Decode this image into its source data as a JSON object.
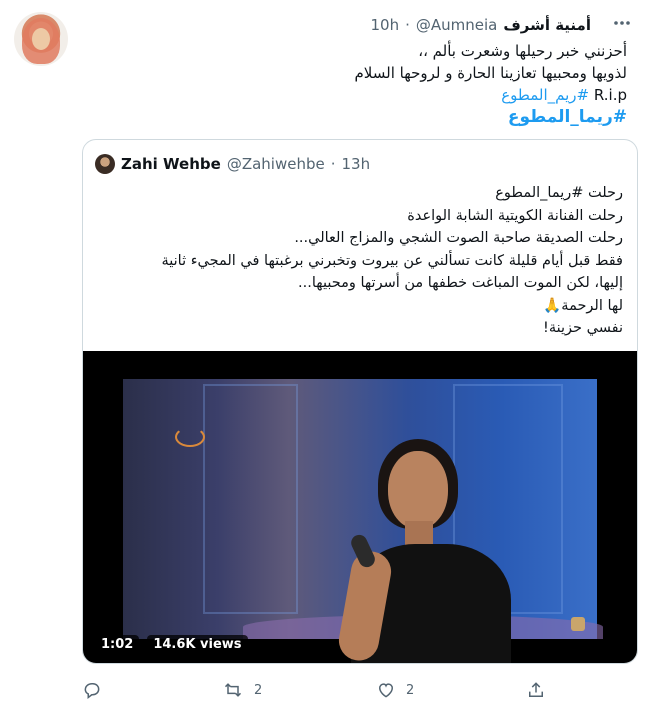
{
  "tweet": {
    "display_name": "أمنية أشرف",
    "handle": "@Aumneia",
    "separator": "·",
    "time": "10h",
    "lines": [
      "أحزنني خبر رحيلها وشعرت بألم ،،",
      "لذويها ومحبيها تعازينا الحارة و لروحها السلام"
    ],
    "rip_text": "R.i.p",
    "hashtag_inline": "#ريم_المطوع",
    "hashtag_bold": "#ريما_المطوع"
  },
  "quote": {
    "display_name": "Zahi Wehbe",
    "handle": "@Zahiwehbe",
    "separator": "·",
    "time": "13h",
    "lines": [
      "رحلت #ريما_المطوع",
      "رحلت الفنانة الكويتية الشابة الواعدة",
      "رحلت الصديقة صاحبة الصوت الشجي والمزاج العالي...",
      "فقط قبل أيام قليلة كانت تسألني عن بيروت وتخبرني برغبتها في المجيء ثانية",
      "إليها، لكن الموت المباغت خطفها من أسرتها ومحبيها...",
      "لها الرحمة🙏",
      "نفسي حزينة!"
    ],
    "video": {
      "duration": "1:02",
      "views": "14.6K views"
    }
  },
  "actions": {
    "reply_icon": "reply-icon",
    "retweet_icon": "retweet-icon",
    "retweet_count": "2",
    "like_icon": "heart-icon",
    "like_count": "2",
    "share_icon": "share-icon"
  }
}
